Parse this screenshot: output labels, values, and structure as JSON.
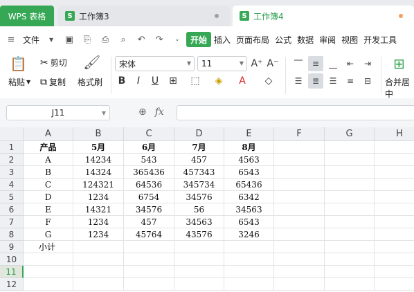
{
  "app_tab": "WPS 表格",
  "doc_tabs": [
    {
      "label": "工作簿3",
      "icon": "S"
    },
    {
      "label": "工作簿4",
      "icon": "S"
    }
  ],
  "menu": {
    "file": "文件",
    "items": [
      "开始",
      "插入",
      "页面布局",
      "公式",
      "数据",
      "审阅",
      "视图",
      "开发工具"
    ],
    "active": "开始"
  },
  "ribbon": {
    "paste": "粘贴",
    "cut": "剪切",
    "copy": "复制",
    "format_painter": "格式刷",
    "font_name": "宋体",
    "font_size": "11",
    "merge_center": "合并居中"
  },
  "formula_bar": {
    "name_box": "J11",
    "fx_label": "fx",
    "formula": ""
  },
  "sheet": {
    "columns": [
      "A",
      "B",
      "C",
      "D",
      "E",
      "F",
      "G",
      "H"
    ],
    "rows": [
      "1",
      "2",
      "3",
      "4",
      "5",
      "6",
      "7",
      "8",
      "9",
      "10",
      "11",
      "12"
    ],
    "active_row": "11",
    "header_row": [
      "产品",
      "5月",
      "6月",
      "7月",
      "8月"
    ],
    "data": [
      [
        "A",
        "14234",
        "543",
        "457",
        "4563"
      ],
      [
        "B",
        "14324",
        "365436",
        "457343",
        "6543"
      ],
      [
        "C",
        "124321",
        "64536",
        "345734",
        "65436"
      ],
      [
        "D",
        "1234",
        "6754",
        "34576",
        "6342"
      ],
      [
        "E",
        "14321",
        "34576",
        "56",
        "34563"
      ],
      [
        "F",
        "1234",
        "457",
        "34563",
        "6543"
      ],
      [
        "G",
        "1234",
        "45764",
        "43576",
        "3246"
      ]
    ],
    "subtotal_label": "小计"
  },
  "colors": {
    "accent": "#36a855"
  }
}
